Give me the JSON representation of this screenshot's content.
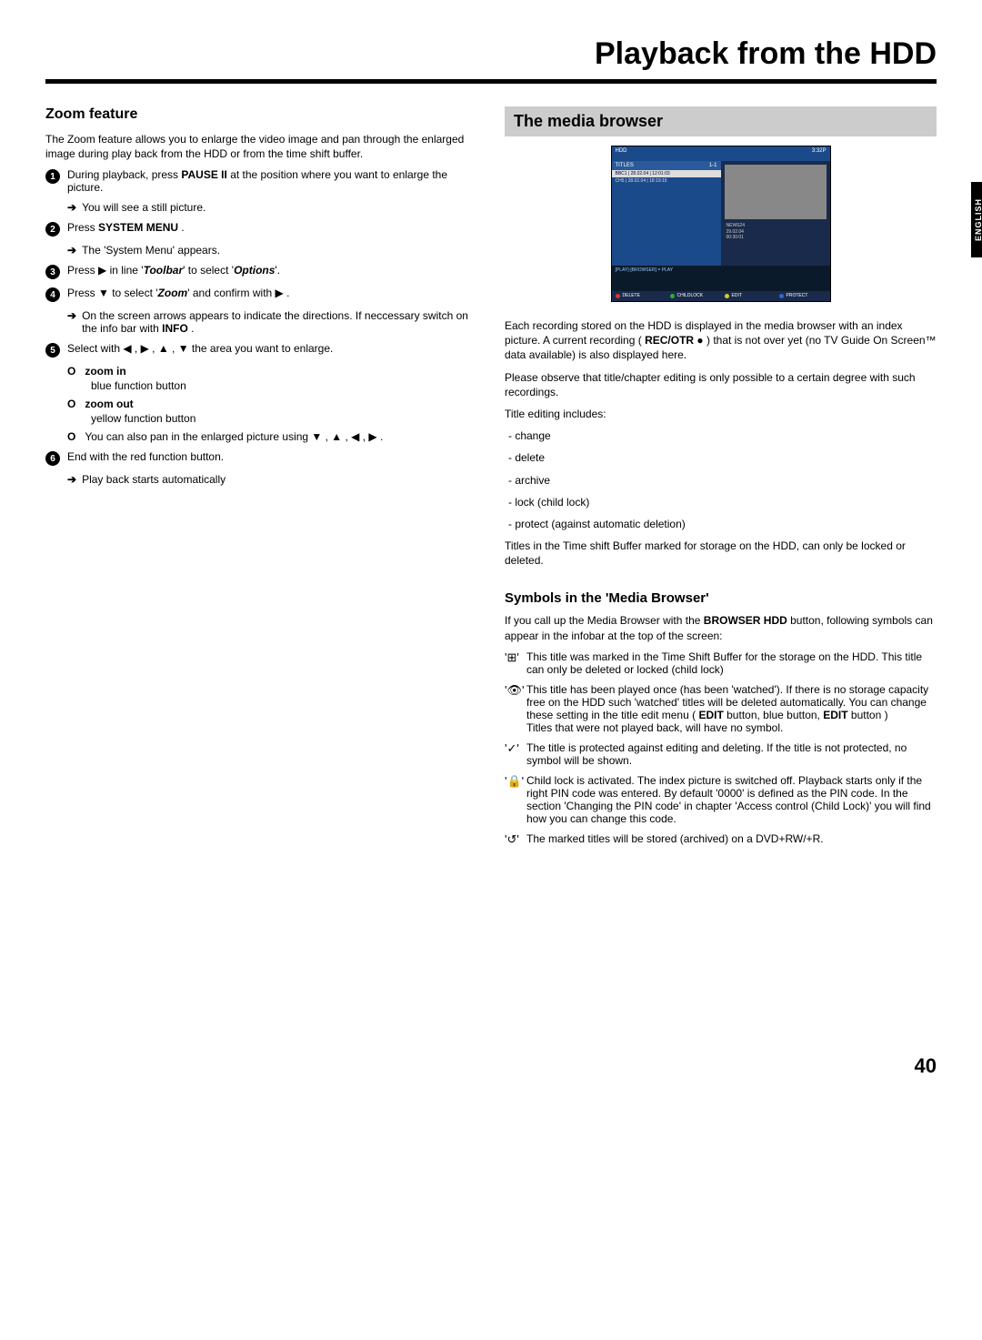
{
  "header": {
    "title": "Playback from the HDD"
  },
  "lang_tab": "ENGLISH",
  "page_number": "40",
  "left": {
    "heading": "Zoom feature",
    "intro": "The Zoom feature allows you to enlarge the video image and pan through the enlarged image during play back from the HDD or from the time shift buffer.",
    "steps": {
      "s1": {
        "text_a": "During playback, press ",
        "key1": "PAUSE II",
        "text_b": " at the position where you want to enlarge the picture.",
        "sub": "You will see a still picture."
      },
      "s2": {
        "text_a": "Press ",
        "key1": "SYSTEM MENU",
        "text_b": " .",
        "sub": "The 'System Menu' appears."
      },
      "s3": {
        "text_a": "Press ▶ in line '",
        "em1": "Toolbar",
        "text_b": "' to select '",
        "em2": "Options",
        "text_c": "'."
      },
      "s4": {
        "text_a": "Press ▼ to select '",
        "em1": "Zoom",
        "text_b": "' and confirm with ▶ .",
        "sub": "On the screen arrows appears to indicate the directions. If neccessary switch on the info bar with ",
        "key1": "INFO",
        "sub_b": " ."
      },
      "s5": {
        "text": "Select with ◀ , ▶ , ▲ , ▼ the area you want to enlarge.",
        "opt1": {
          "label": "zoom in",
          "desc": "blue function button"
        },
        "opt2": {
          "label": "zoom out",
          "desc": "yellow function button"
        },
        "opt3": {
          "text": "You can also pan in the enlarged picture using ▼ , ▲ , ◀ , ▶ ."
        }
      },
      "s6": {
        "text": "End with the red function button.",
        "sub": "Play back starts automatically"
      }
    }
  },
  "right": {
    "heading": "The media browser",
    "screenshot": {
      "top_left": "HDD",
      "top_right": "3:32P",
      "list_head_l": "TITLES",
      "list_head_r": "1-1",
      "row1": "BBC1 | 28.02.04 | 12:01:03",
      "row2": "CH5 | 28.02.04 | 18:19:15",
      "meta1": "NEWS24",
      "meta2": "29.02.04",
      "meta3": "00:30:01",
      "info": "[PLAY]-[BROWSER] = PLAY",
      "fn_red": "DELETE",
      "fn_grn": "CHILDLOCK",
      "fn_yel": "EDIT",
      "fn_blu": "PROTECT"
    },
    "p1_a": "Each recording stored on the HDD is displayed in the media browser with an index picture. A current recording ( ",
    "p1_key": "REC/OTR",
    "p1_b": " ● ) that is not over yet (no TV Guide On Screen™ data available) is also displayed here.",
    "p2": "Please observe that title/chapter editing is only possible to a certain degree with such recordings.",
    "edit_intro": "Title editing includes:",
    "edit_items": [
      "- change",
      "- delete",
      "- archive",
      "- lock (child lock)",
      "- protect (against automatic deletion)"
    ],
    "p3": "Titles in the Time shift Buffer marked for storage on the HDD, can only be locked or deleted.",
    "symbols": {
      "heading": "Symbols in the 'Media Browser'",
      "intro_a": "If you call up the Media Browser with the ",
      "intro_key": "BROWSER HDD",
      "intro_b": " button, following symbols can appear in the infobar at the top of the screen:",
      "items": [
        {
          "icon": "⊞",
          "text": "This title was marked in the Time Shift Buffer for the storage on the HDD. This title can only be deleted or locked (child lock)"
        },
        {
          "icon": "👁",
          "text_a": "This title has been played once (has been 'watched'). If there is no storage capacity free on the HDD such 'watched' titles will be deleted automatically. You can change these setting in the title edit menu ( ",
          "key1": "EDIT",
          "mid1": " button, blue button, ",
          "key2": "EDIT",
          "text_b": " button )",
          "line2": "Titles that were not played back, will have no symbol."
        },
        {
          "icon": "✓",
          "text": "The title is protected against editing and deleting. If the title is not protected, no symbol will be shown."
        },
        {
          "icon": "🔒",
          "text": "Child lock is activated. The index picture is switched off. Playback starts only if the right PIN code was entered. By default '0000' is defined as the PIN code. In the section 'Changing the PIN code' in chapter 'Access control (Child Lock)' you will find how you can change this code."
        },
        {
          "icon": "↺",
          "text": "The marked titles will be stored (archived) on a DVD+RW/+R."
        }
      ]
    }
  }
}
